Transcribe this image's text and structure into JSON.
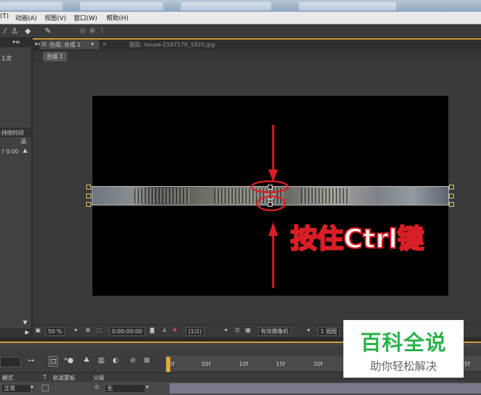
{
  "menu": {
    "items": [
      "(T)",
      "动画(A)",
      "视图(V)",
      "窗口(W)",
      "帮助(H)"
    ]
  },
  "left_panel": {
    "text1": "1次",
    "text2": "持续时间",
    "text3": "? 0:00"
  },
  "composition_panel": {
    "tab_label": "合成: 合成 1",
    "layer_label": "图层: house-2187170_1920.jpg",
    "subtab": "合成 1"
  },
  "viewer_controls": {
    "zoom": "50 %",
    "timecode": "0:00:00:00",
    "resolution": "(1/2)",
    "camera": "有效摄像机",
    "views": "1 视图"
  },
  "annotation": {
    "text": "按住Ctrl键"
  },
  "timeline": {
    "ruler_ticks": [
      "0f",
      "05f",
      "10f",
      "15f",
      "20f",
      "5f"
    ],
    "col_mode": "模式",
    "col_t": "T",
    "col_track": "轨道蒙板",
    "col_parent": "父级",
    "row_mode": "正常",
    "row_parent": "无"
  },
  "watermark": {
    "title": "百科全说",
    "subtitle": "助你轻松解决"
  },
  "colors": {
    "accent_orange": "#d5a23a",
    "annotation_red": "#d81f26",
    "watermark_green": "#2bb24c"
  }
}
